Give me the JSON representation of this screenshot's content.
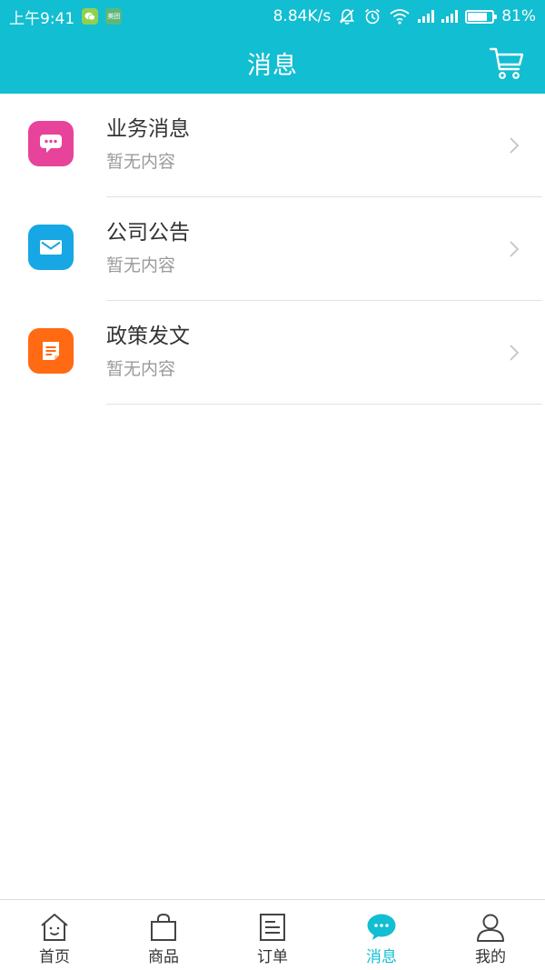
{
  "status_bar": {
    "time": "上午9:41",
    "app_badges": [
      "wechat-icon",
      "meituan-icon"
    ],
    "meituan_text": "美团",
    "network_speed": "8.84K/s",
    "battery_percent": "81%",
    "battery_level": 0.81
  },
  "header": {
    "title": "消息",
    "cart_icon": "cart-icon"
  },
  "colors": {
    "brand": "#12bed1",
    "business_icon_bg": "#e8439a",
    "announcement_icon_bg": "#17a7e4",
    "policy_icon_bg": "#ff6a12"
  },
  "messages": [
    {
      "title": "业务消息",
      "subtitle": "暂无内容",
      "icon": "chat-bubble-icon"
    },
    {
      "title": "公司公告",
      "subtitle": "暂无内容",
      "icon": "envelope-icon"
    },
    {
      "title": "政策发文",
      "subtitle": "暂无内容",
      "icon": "document-icon"
    }
  ],
  "tabs": [
    {
      "label": "首页",
      "icon": "home-icon",
      "active": false
    },
    {
      "label": "商品",
      "icon": "shopping-bag-icon",
      "active": false
    },
    {
      "label": "订单",
      "icon": "order-list-icon",
      "active": false
    },
    {
      "label": "消息",
      "icon": "message-icon",
      "active": true
    },
    {
      "label": "我的",
      "icon": "user-icon",
      "active": false
    }
  ]
}
